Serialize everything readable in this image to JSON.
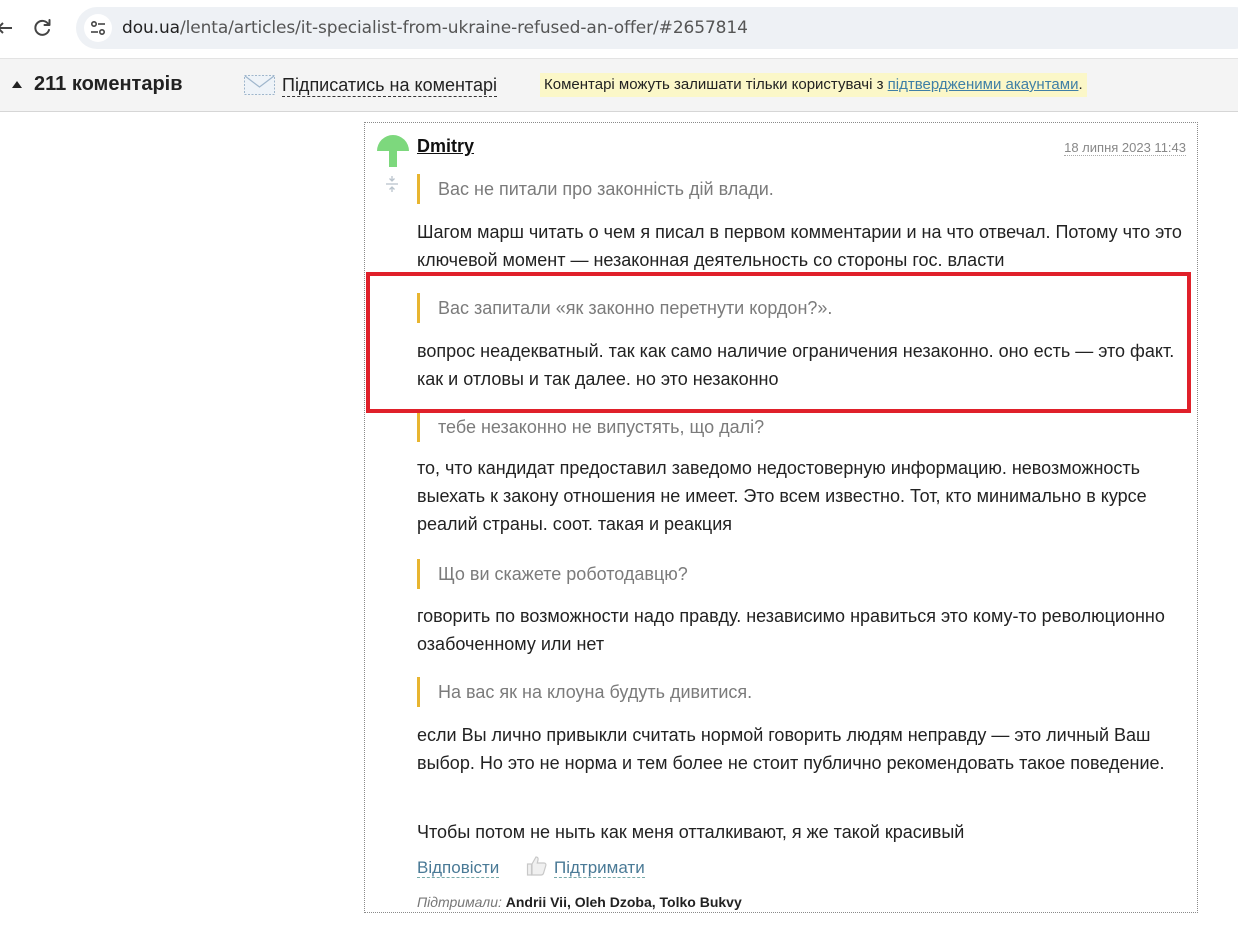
{
  "browser": {
    "url_domain": "dou.ua",
    "url_path": "/lenta/articles/it-specialist-from-ukraine-refused-an-offer/#2657814"
  },
  "comments_bar": {
    "count_label": "211 коментарів",
    "subscribe_label": "Підписатись на коментарі",
    "notice_prefix": "Коментарі можуть залишати тільки користувачі з ",
    "notice_link": "підтвердженими акаунтами",
    "notice_suffix": "."
  },
  "comment": {
    "author": "Dmitry",
    "date": "18 липня 2023 11:43",
    "quote1": "Вас не питали про законність дій влади.",
    "text1": "Шагом марш читать о чем я писал в первом комментарии и на что отвечал. Потому что это ключевой момент — незаконная деятельность со стороны гос. власти",
    "quote2": "Вас запитали «як законно перетнути кордон?».",
    "text2": "вопрос неадекватный. так как само наличие ограничения незаконно. оно есть — это факт. как и отловы и так далее. но это незаконно",
    "quote3": "тебе незаконно не випустять, що далі?",
    "text3": "то, что кандидат предоставил заведомо недостоверную информацию. невозможность выехать к закону отношения не имеет. Это всем известно. Тот, кто минимально в курсе реалий страны. соот. такая и реакция",
    "quote4": "Що ви скажете роботодавцю?",
    "text4": "говорить по возможности надо правду. независимо нравиться это кому-то революционно озабоченному или нет",
    "quote5": "На вас як на клоуна будуть дивитися.",
    "text5": "если Вы лично привыкли считать нормой говорить людям неправду — это личный Ваш выбор. Но это не норма и тем более не стоит публично рекомендовать такое поведение.",
    "text6": "Чтобы потом не ныть как меня отталкивают, я же такой красивый",
    "reply_label": "Відповісти",
    "support_label": "Підтримати",
    "supported_prefix": "Підтримали:",
    "supported_names": "Andrii Vii, Oleh Dzoba, Tolko Bukvy"
  },
  "colors": {
    "quote_border": "#e8b530",
    "highlight_box": "#e0202a",
    "notice_bg": "#fbf7c8",
    "link": "#4a7a96",
    "avatar": "#7dd87d"
  }
}
